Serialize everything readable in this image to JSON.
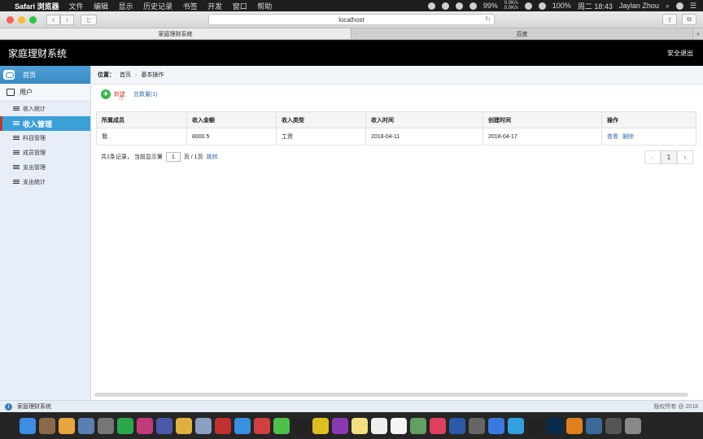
{
  "menubar": {
    "app_name": "Safari 浏览器",
    "menus": [
      "文件",
      "编辑",
      "显示",
      "历史记录",
      "书签",
      "开发",
      "窗口",
      "帮助"
    ],
    "battery": "99%",
    "net_speed_up": "0.0K/s",
    "net_speed_down": "0.0K/s",
    "battery2": "100%",
    "clock": "周二 18:43",
    "user": "Jaylan Zhou"
  },
  "browser": {
    "url": "localhost",
    "tabs": [
      "家庭理财系统",
      "百度"
    ]
  },
  "app": {
    "title": "家庭理财系统",
    "logout": "安全退出"
  },
  "sidebar": {
    "home": "首页",
    "group": "用户",
    "items": [
      "收入统计",
      "收入管理",
      "科目管理",
      "成员管理",
      "支出管理",
      "支出统计"
    ]
  },
  "breadcrumb": {
    "label": "位置：",
    "home": "首页",
    "current": "基本操作"
  },
  "actions": {
    "new": "新建",
    "count": "总数量(1)"
  },
  "table": {
    "headers": [
      "所属成员",
      "收入金额",
      "收入类型",
      "收入时间",
      "创建时间",
      "操作"
    ],
    "rows": [
      [
        "我",
        "8000.5",
        "工资",
        "2018-04-11",
        "2018-04-17"
      ]
    ],
    "view": "查看",
    "delete": "删除"
  },
  "pager": {
    "prefix": "共1条记录，  当前显示第",
    "page": "1",
    "suffix": "页 / 1页",
    "jump": "跳转",
    "current_btn": "1"
  },
  "status": {
    "left": "家庭理财系统",
    "right": "版权所有 @ 2018"
  }
}
